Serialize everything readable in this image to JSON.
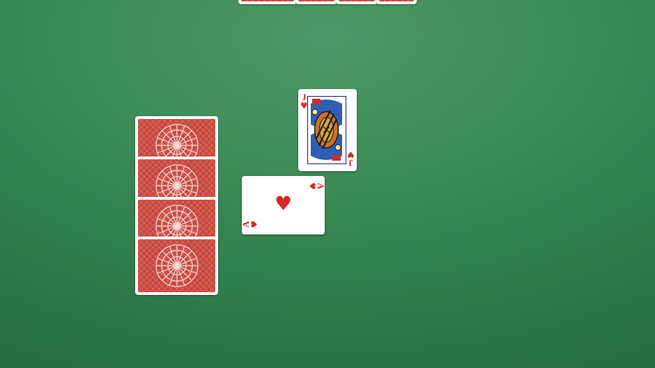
{
  "table": {
    "felt_color": "#3f8d59"
  },
  "colors": {
    "card_back": "#c8473e",
    "hearts": "#d42a22",
    "card_face": "#ffffff"
  },
  "top_row": {
    "cards": [
      {
        "id": 1,
        "face": "down"
      },
      {
        "id": 2,
        "face": "down"
      },
      {
        "id": 3,
        "face": "down"
      },
      {
        "id": 4,
        "face": "down"
      }
    ]
  },
  "left_column": {
    "cards": [
      {
        "id": 1,
        "face": "down"
      },
      {
        "id": 2,
        "face": "down"
      },
      {
        "id": 3,
        "face": "down"
      },
      {
        "id": 4,
        "face": "down"
      }
    ]
  },
  "played": {
    "jack": {
      "rank": "J",
      "suit": "♥",
      "suit_name": "hearts"
    },
    "ace": {
      "rank": "A",
      "suit": "♥",
      "suit_name": "hearts"
    }
  }
}
